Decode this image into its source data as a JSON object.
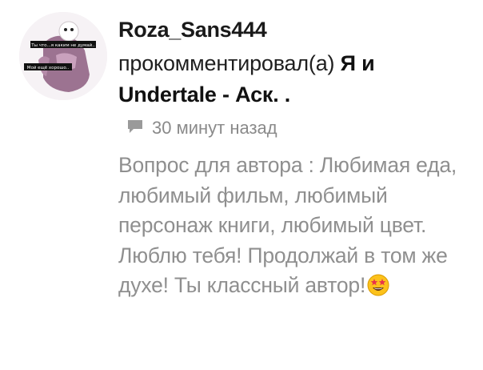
{
  "notification": {
    "author": "Roza_Sans444",
    "action": "прокомментировал(а)",
    "target_title": "Я и Undertale - Аск. .",
    "time_ago": "30 минут назад",
    "comment_text": "Вопрос для автора : Любимая еда, любимый фильм, любимый персонаж книги, любимый цвет. Люблю тебя! Продолжай в том же духе! Ты классный автор!",
    "avatar_caption_top": "Ты что...я каким не думай..",
    "avatar_caption_bottom": "Мой ещё хорошо..",
    "icons": {
      "comment": "comment-bubble-icon",
      "emoji": "star-struck-emoji-icon"
    },
    "colors": {
      "author": "#1a1a1a",
      "body_text": "#8f8f8f",
      "meta_text": "#8a8a8a",
      "emoji_face": "#fcc21b",
      "emoji_star": "#e8344b"
    }
  }
}
